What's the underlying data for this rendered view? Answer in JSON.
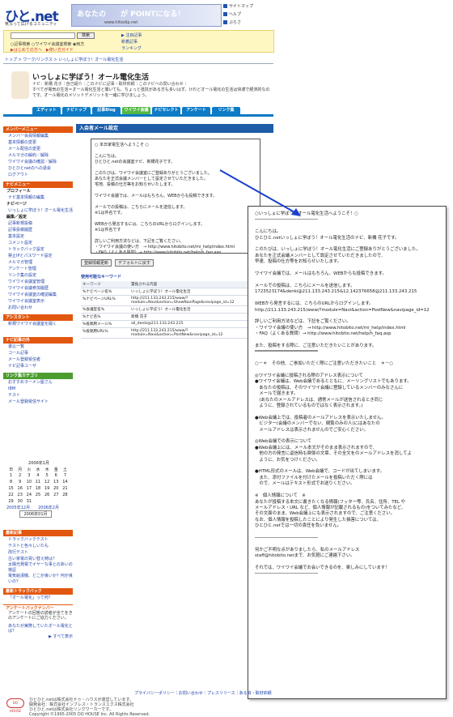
{
  "header": {
    "logo": "ひと.net",
    "tagline": "気なって広げるコミュニティ",
    "banner_text": "あなたの　　が POINTになる！",
    "banner_sub": "www.hitoslip.net",
    "toplinks": [
      "サイトマップ",
      "ヘルプ",
      "ぷらさ"
    ]
  },
  "search": {
    "placeholder": "",
    "button": "検索",
    "options": "○記事検索 ○ワイワイ会議室検索 ◉両方",
    "advanced": "▶はじめての方へ　▶使い方ガイド",
    "links": [
      "▶ 注目記事",
      "新着記事",
      "ランキング"
    ]
  },
  "breadcrumb": "トップ > ワーク/リンクス > いっしょに学ぼう！オール電化生活",
  "profile": {
    "title": "いっしょに学ぼう！オール電化生活",
    "author": "ナビ：新橋 花子｜自己紹介｜このナビに記事・取材依頼｜このナビへの問い合わせ｜",
    "description": "すべてが電気の生活＝オール電化生活と聞いても、ちょっと抵抗がある方も多いはず。けれどオール電化の生活は快適で経済的なのです。オール電化のメリットデメリットを一緒に学びましょう。"
  },
  "tabs": [
    "エディット",
    "ナビトップ",
    "記事Blog",
    "ワイワイ会議",
    "ナビセレクト",
    "アンケート",
    "リンク集"
  ],
  "sidebar": {
    "menu_title": "メンバーメニュー",
    "menu_items": [
      "メンバー会員情報編集",
      "基本情報の変更",
      "メール配信の変更",
      "メルマガの解約／解除",
      "ワイワイ会議の確認／解除",
      "ひとひとnetのへの退会",
      "ログアウト"
    ],
    "navi_title": "ナビメニュー",
    "navi_items": [
      "プロフィール",
      "ナビ基本情報の編集",
      "ナビページ",
      "いっしょに学ぼう！オール電化生活",
      "編集／設定",
      "記事新規投稿",
      "記事投稿履歴",
      "基本設定",
      "コメント設定",
      "トラックバック設定",
      "禁止IPとパスワード設定",
      "メルマガ管理",
      "アンケート管理",
      "リンク集の設定",
      "ワイワイ会議室管理",
      "ワイワイ会議参加履歴",
      "ワイワイ会議室の確認編集",
      "ワイワイ会議室表示",
      "お問い合わせ"
    ],
    "assist_title": "アシスタント",
    "assist_text": "新規ワイワイ会議室を開く",
    "navi_more_title": "ナビ記事の外",
    "navi_more_items": [
      "書込一覧",
      "コール記事",
      "メール登録受信者",
      "ナビ記事ユーザ"
    ],
    "link_title": "リンク集カテゴリ",
    "link_items": [
      "おすすめラーメン屋さん",
      "IBM",
      "テスト",
      "メール登録受信サイト"
    ],
    "calendar_title": "2006年1月",
    "calendar_days": [
      "日",
      "月",
      "火",
      "水",
      "木",
      "金",
      "土"
    ],
    "calendar_rows": [
      [
        "1",
        "2",
        "3",
        "4",
        "5",
        "6",
        "7"
      ],
      [
        "8",
        "9",
        "10",
        "11",
        "12",
        "13",
        "14"
      ],
      [
        "15",
        "16",
        "17",
        "18",
        "19",
        "20",
        "21"
      ],
      [
        "22",
        "23",
        "24",
        "25",
        "26",
        "27",
        "28"
      ],
      [
        "29",
        "30",
        "31",
        "",
        "",
        "",
        ""
      ]
    ],
    "calendar_nav": "2005年12月　　2006年2月",
    "calendar_select": "2006年01月",
    "recent_title": "最新記事",
    "recent_items": [
      "トラックバックテスト",
      "テストと色々しいたも",
      "改行テスト",
      "古い家電の買い替え時は？",
      "太陽光発電でイヤーな事とのあいの検証",
      "電気給湯機、どこが良いか？何が良いの？"
    ],
    "tb_title": "最新トラックバック",
    "tb_items": [
      "「オール電化」って何？"
    ],
    "survey_title": "アンケートバックナンバー",
    "survey_text": "アンケートの回答の読者が全てをきのアンケートにご協力ください。",
    "survey_items": [
      "あなたが実際していたオール電化とは？"
    ],
    "survey_more": "▶ すべて表示"
  },
  "main": {
    "heading": "入会者メール設定",
    "preview": "○ 本日家電生活へようこそ ○\n\nこんにちは。\nひとひと.netの会議室ナビ、新橋花子です。\n\nこのたびは、ワイワイ会議室にご登録ありがとうございました。\nあなたを正式会議メンバーとして設定させていただきました。\n宅地、投稿の仕方等をお知らせいたします。\n\nワイワイ会議では、メールはもちろん、WEBからも投稿できます。\n\nメールでの投稿は、こちらにメールを送信します。\n※1は件名です。\n\nWEBから発言するには、こちらのURLからログインします。\n※1は件名です\n\n詳しいご利用方法などは、下記をご覧ください。\n・ワイワイ会議の使い方　→ http://www.hitobito.net/mi_help/index.html\n・FAQ（よくある質問）→ http://www.hitobito.net/help/h_faq.asp\n\nまた、投稿するときには、ご注意いただきたいことがあります。",
    "save_button": "登録情報更新",
    "default_button": "デフォルトに戻す",
    "keyword_title": "使用可能なキーワード",
    "keyword_headers": [
      "キーワード",
      "置換される内容"
    ],
    "keywords": [
      [
        "%ナビページ名%",
        "いっしょに学ぼう！オール電化生活"
      ],
      [
        "%ナビページURL%",
        "http://211.133.243.215/www/?module=Navi&action=ShowNaviPage&navipage_id=12"
      ],
      [
        "%会議室名%",
        "いっしょに学ぼう！オール電化生活"
      ],
      [
        "%ナビ名%",
        "新橋 花子"
      ],
      [
        "%投稿用メール%",
        "all_denki@211.133.243.215"
      ],
      [
        "%投稿用URL%",
        "http://211.133.243.215/www/?module=Navi&action=PostNew&navipage_id=12"
      ]
    ]
  },
  "popup": {
    "text": "○いっしょに学ぼう！オール電化生活へようこそ！○\n────────────────────────\n\nこんにちは。\nひとひと.netいっしょに学ぼう！オール電化生活のナビ、新橋 花子です。\n\nこのたびは、いっしょに学ぼう！オール電化生活にご登録ありがとうございました。\nあなたを正式会議メンバーとして設定させていただきましたので、\n早速、投稿の仕方等をお知らせいたします。\n\nワイワイ会議では、メールはもちろん、WEBからも投稿できます。\n\nメールでの投稿は、こちらにメールを送信します。\n1723523174&denki@211.133.243.215&12.142376658@211.133.243.215\n\nWEBから発言するには、こちらのURLからログインします。\nhttp://211.133.243.215/www/?module=Navi&action=PostNew&navipage_id=12\n\n詳しいご利用方法などは、下記をご覧ください。\n・ワイワイ会議の使い方　→ http://www.hitobito.net/mi_help/index.html\n・FAQ（よくある質問）→ http://www.hitobito.net/help/h_faq.asp\n\nまた、投稿をする際に、ご注意いただきたいことがあります。\n════════════════════════\n\n○－＊　その他、ご参加いただく際にご注意いただきたいこと　＊－○\n\n◎ワイワイ会議に投稿される際のアドレス表示について\n●ワイワイ会議は、Web会議であるとともに、メーリングリストでもあります。\n　あなたの投稿は、そのワイワイ会議に登録しているメンバーのみなさんに\n　メールで届きます。\n　(あなたのメールアドレスは、通常メールが送信されるとき同じ\n　ように、登録されているものではなく表示されます。)\n\n●Web会議上では、投稿者のメールアドレスを表示いたしません。\n　ビジター(会議のメンバーでない、閲覧のみの人)にはあなたの\n　メールアドレスは表示されませんのでご安心ください。\n\n◎Web会議での表示について\n●Web会議上には、メール本文がそのまま表示されますので、\n　他の方の発言に返信時も関係の文章、その全文をのメールアドレスを消してよ\n　ように、お気をつけください。\n\n●HTML形式のメールは、Web会議で、コードが出てしまいます。\n　また、添付ファイルを付けたメールを投稿いただく際には\n　ので、メールはテキスト形式でお送りください。\n\n※　個人情報について　※\nあなたが投稿する本文に書きたくなる情報(フッター等、氏名、住所、TEL や\nメールアドレス・URL など、個人情報が記載されるもの)をついてみたなど、\nその文面のまま、Web会議上にも表示されますので、ご注意ください。\nなお、個人情報を投稿したことにより発生した損害については、\nひとひと.netでは一切の責任を負いません。\n\n────────────────────────\n\n何かご不明な点がありましたら、私のメールアドレス\nstaff@hitobito.netまで、お気軽にご連絡下さい。\n\nそれでは、ワイワイ会議でお会いできるのを、楽しみにしています！\n────────────────────────"
  },
  "footer": {
    "links": "プライバシーポリシー｜お問い合わせ｜プレスリリース｜ある資・取材依頼",
    "line1": "ひとひと.netは株式会社ドゥ・ハウスが運営しています。",
    "line2": "開発会社：株式会社インブレス・トランスエクス株式会社",
    "line3": "ひとひと.netは株式会社リンクワーカーです。",
    "copyright": "Copyright ©1995-2005 DO HOUSE Inc. All Rights Reserved.",
    "logo": "DO HOUSE"
  },
  "colors": {
    "accent_blue": "#0d7bc6",
    "menu_orange": "#e2570f",
    "menu_green": "#4a9d2e",
    "search_yellow": "#fff7c2"
  }
}
